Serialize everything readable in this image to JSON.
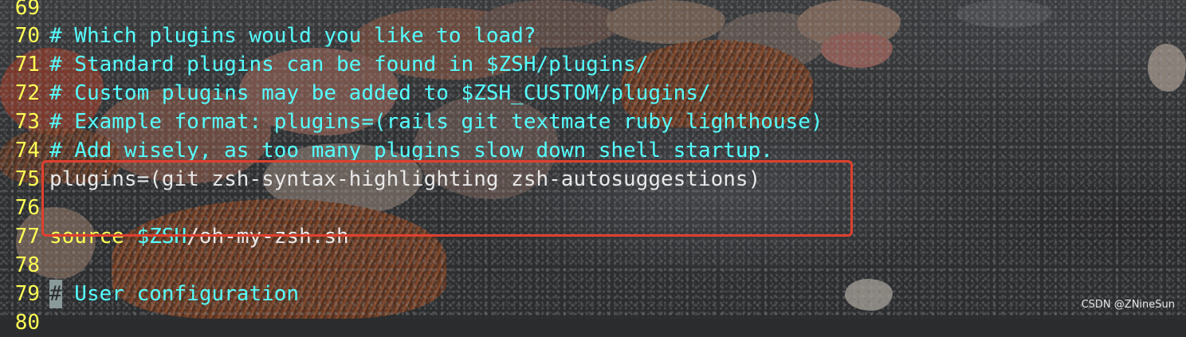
{
  "terminal": {
    "lines": [
      {
        "num": "69",
        "text": ""
      },
      {
        "num": "70",
        "text": "# Which plugins would you like to load?"
      },
      {
        "num": "71",
        "text": "# Standard plugins can be found in $ZSH/plugins/"
      },
      {
        "num": "72",
        "text": "# Custom plugins may be added to $ZSH_CUSTOM/plugins/"
      },
      {
        "num": "73",
        "text": "# Example format: plugins=(rails git textmate ruby lighthouse)"
      },
      {
        "num": "74",
        "text": "# Add wisely, as too many plugins slow down shell startup."
      },
      {
        "num": "75",
        "text": "plugins=(git zsh-syntax-highlighting zsh-autosuggestions)"
      },
      {
        "num": "76",
        "text": ""
      },
      {
        "num": "77",
        "keyword": "source",
        "variable": "$ZSH",
        "rest": "/oh-my-zsh.sh"
      },
      {
        "num": "78",
        "text": ""
      },
      {
        "num": "79",
        "cursor": "#",
        "text": " User configuration"
      },
      {
        "num": "80",
        "text": ""
      }
    ]
  },
  "watermark": "CSDN @ZNineSun",
  "colors": {
    "line_number": "#ffff55",
    "comment": "#55ffff",
    "plain": "#e8e8e8",
    "highlight_box": "#e0402f"
  }
}
